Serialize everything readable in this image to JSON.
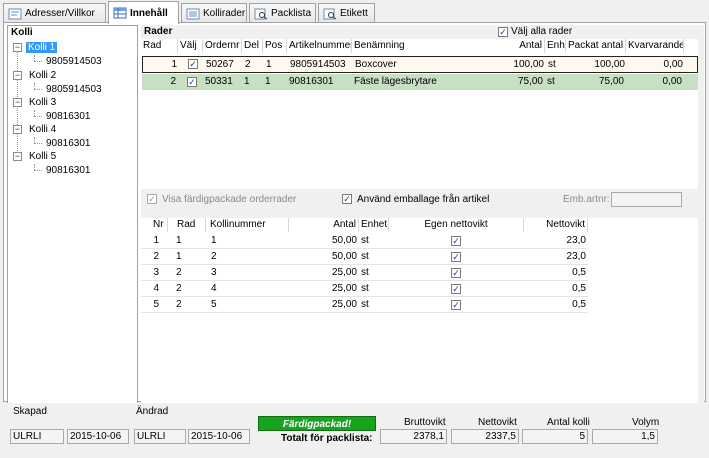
{
  "tabs": [
    {
      "label": "Adresser/Villkor",
      "icon": "address-icon"
    },
    {
      "label": "Innehåll",
      "icon": "table-icon"
    },
    {
      "label": "Kollirader",
      "icon": "list-icon"
    },
    {
      "label": "Packlista",
      "icon": "search-doc-icon"
    },
    {
      "label": "Etikett",
      "icon": "search-doc-icon"
    }
  ],
  "kolli": {
    "title": "Kolli",
    "items": [
      {
        "label": "Kolli 1",
        "child": "9805914503",
        "selected": true
      },
      {
        "label": "Kolli 2",
        "child": "9805914503"
      },
      {
        "label": "Kolli 3",
        "child": "90816301"
      },
      {
        "label": "Kolli 4",
        "child": "90816301"
      },
      {
        "label": "Kolli 5",
        "child": "90816301"
      }
    ]
  },
  "rader": {
    "title": "Rader",
    "select_all_label": "Välj alla rader",
    "columns": [
      "Rad",
      "Välj",
      "Ordernr",
      "Del",
      "Pos",
      "Artikelnummer",
      "Benämning",
      "Antal",
      "Enh.",
      "Packat antal",
      "Kvarvarande"
    ],
    "rows": [
      {
        "rad": "1",
        "ordernr": "50267",
        "del": "2",
        "pos": "1",
        "artikelnummer": "9805914503",
        "benamning": "Boxcover",
        "antal": "100,00",
        "enh": "st",
        "packat": "100,00",
        "kvar": "0,00"
      },
      {
        "rad": "2",
        "ordernr": "50331",
        "del": "1",
        "pos": "1",
        "artikelnummer": "90816301",
        "benamning": "Fäste lägesbrytare",
        "antal": "75,00",
        "enh": "st",
        "packat": "75,00",
        "kvar": "0,00"
      }
    ]
  },
  "options": {
    "visa_label": "Visa färdigpackade orderrader",
    "anvand_label": "Använd emballage från artikel",
    "emb_label": "Emb.artnr:",
    "emb_value": ""
  },
  "kollirader": {
    "columns": [
      "Nr",
      "Rad",
      "Kollinummer",
      "Antal",
      "Enhet",
      "Egen nettovikt",
      "Nettovikt"
    ],
    "rows": [
      {
        "nr": "1",
        "rad": "1",
        "kollinummer": "1",
        "antal": "50,00",
        "enhet": "st",
        "nettovikt": "23,0"
      },
      {
        "nr": "2",
        "rad": "1",
        "kollinummer": "2",
        "antal": "50,00",
        "enhet": "st",
        "nettovikt": "23,0"
      },
      {
        "nr": "3",
        "rad": "2",
        "kollinummer": "3",
        "antal": "25,00",
        "enhet": "st",
        "nettovikt": "0,5"
      },
      {
        "nr": "4",
        "rad": "2",
        "kollinummer": "4",
        "antal": "25,00",
        "enhet": "st",
        "nettovikt": "0,5"
      },
      {
        "nr": "5",
        "rad": "2",
        "kollinummer": "5",
        "antal": "25,00",
        "enhet": "st",
        "nettovikt": "0,5"
      }
    ]
  },
  "footer": {
    "skapad_label": "Skapad",
    "skapad_user": "ULRLI",
    "skapad_date": "2015-10-06",
    "andrad_label": "Ändrad",
    "andrad_user": "ULRLI",
    "andrad_date": "2015-10-06",
    "status_badge": "Färdigpackad!",
    "total_label": "Totalt för packlista:",
    "bruttovikt_label": "Bruttovikt",
    "bruttovikt": "2378,1",
    "nettovikt_label": "Nettovikt",
    "nettovikt": "2337,5",
    "antal_kolli_label": "Antal kolli",
    "antal_kolli": "5",
    "volym_label": "Volym",
    "volym": "1,5"
  },
  "colors": {
    "row1_bg": "#fff8ee",
    "row2_bg": "#c7dfc2",
    "badge_bg": "#17a31c",
    "selection": "#3399ff"
  }
}
